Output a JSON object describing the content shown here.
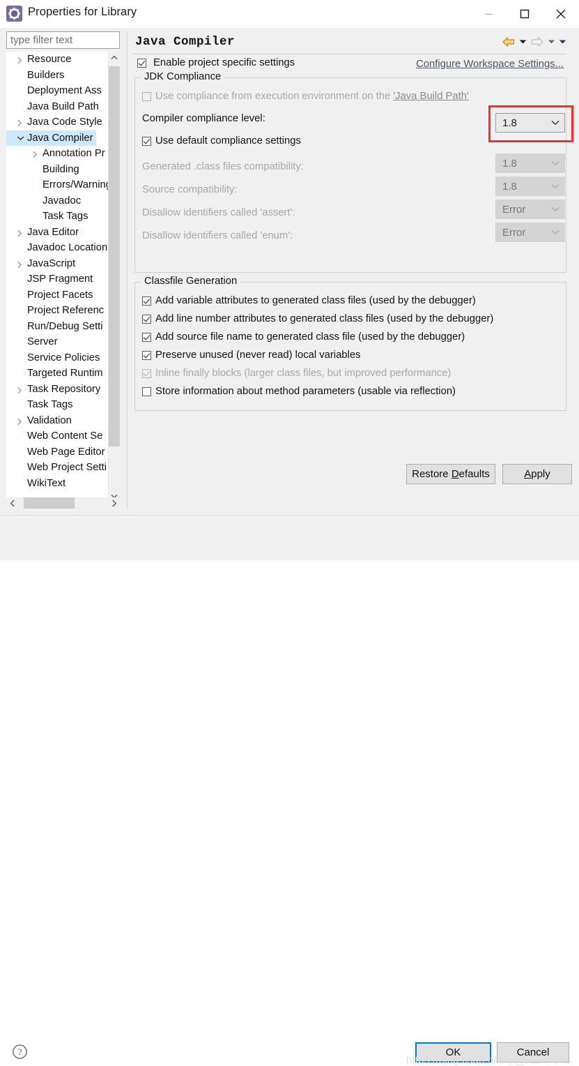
{
  "window": {
    "title": "Properties for Library",
    "icon": "eclipse-properties-icon",
    "minimize_label": "—",
    "maximize_label": "□",
    "close_label": "✕"
  },
  "filter": {
    "placeholder": "type filter text",
    "value": ""
  },
  "tree": {
    "items": [
      {
        "label": "Resource",
        "level": 1,
        "arrow": "collapsed",
        "selected": false
      },
      {
        "label": "Builders",
        "level": 1,
        "arrow": "none",
        "selected": false
      },
      {
        "label": "Deployment Ass",
        "level": 1,
        "arrow": "none",
        "selected": false
      },
      {
        "label": "Java Build Path",
        "level": 1,
        "arrow": "none",
        "selected": false
      },
      {
        "label": "Java Code Style",
        "level": 1,
        "arrow": "collapsed",
        "selected": false
      },
      {
        "label": "Java Compiler",
        "level": 1,
        "arrow": "expanded",
        "selected": true
      },
      {
        "label": "Annotation Pr",
        "level": 2,
        "arrow": "collapsed",
        "selected": false
      },
      {
        "label": "Building",
        "level": 2,
        "arrow": "none",
        "selected": false
      },
      {
        "label": "Errors/Warning",
        "level": 2,
        "arrow": "none",
        "selected": false
      },
      {
        "label": "Javadoc",
        "level": 2,
        "arrow": "none",
        "selected": false
      },
      {
        "label": "Task Tags",
        "level": 2,
        "arrow": "none",
        "selected": false
      },
      {
        "label": "Java Editor",
        "level": 1,
        "arrow": "collapsed",
        "selected": false
      },
      {
        "label": "Javadoc Location",
        "level": 1,
        "arrow": "none",
        "selected": false
      },
      {
        "label": "JavaScript",
        "level": 1,
        "arrow": "collapsed",
        "selected": false
      },
      {
        "label": "JSP Fragment",
        "level": 1,
        "arrow": "none",
        "selected": false
      },
      {
        "label": "Project Facets",
        "level": 1,
        "arrow": "none",
        "selected": false
      },
      {
        "label": "Project Referenc",
        "level": 1,
        "arrow": "none",
        "selected": false
      },
      {
        "label": "Run/Debug Setti",
        "level": 1,
        "arrow": "none",
        "selected": false
      },
      {
        "label": "Server",
        "level": 1,
        "arrow": "none",
        "selected": false
      },
      {
        "label": "Service Policies",
        "level": 1,
        "arrow": "none",
        "selected": false
      },
      {
        "label": "Targeted Runtim",
        "level": 1,
        "arrow": "none",
        "selected": false
      },
      {
        "label": "Task Repository",
        "level": 1,
        "arrow": "collapsed",
        "selected": false
      },
      {
        "label": "Task Tags",
        "level": 1,
        "arrow": "none",
        "selected": false
      },
      {
        "label": "Validation",
        "level": 1,
        "arrow": "collapsed",
        "selected": false
      },
      {
        "label": "Web Content Se",
        "level": 1,
        "arrow": "none",
        "selected": false
      },
      {
        "label": "Web Page Editor",
        "level": 1,
        "arrow": "none",
        "selected": false
      },
      {
        "label": "Web Project Setti",
        "level": 1,
        "arrow": "none",
        "selected": false
      },
      {
        "label": "WikiText",
        "level": 1,
        "arrow": "none",
        "selected": false
      }
    ]
  },
  "page": {
    "title": "Java Compiler",
    "nav": {
      "back_icon": "back-arrow-icon",
      "back_menu_icon": "chevron-down-icon",
      "forward_icon": "forward-arrow-icon",
      "forward_menu_icon": "chevron-down-icon",
      "view_menu_icon": "chevron-down-icon"
    },
    "enable_project_specific": {
      "label": "Enable project specific settings",
      "checked": true
    },
    "configure_workspace_link": "Configure Workspace Settings..."
  },
  "jdk_compliance": {
    "legend": "JDK Compliance",
    "use_execution_env": {
      "label_prefix": "Use compliance from execution environment on the ",
      "label_link": "'Java Build Path'",
      "checked": false,
      "enabled": false
    },
    "compliance_level": {
      "label": "Compiler compliance level:",
      "value": "1.8",
      "enabled": true,
      "highlighted": true
    },
    "use_default_settings": {
      "label": "Use default compliance settings",
      "checked": true,
      "enabled": true
    },
    "fields": [
      {
        "label": "Generated .class files compatibility:",
        "value": "1.8",
        "enabled": false
      },
      {
        "label": "Source compatibility:",
        "value": "1.8",
        "enabled": false
      },
      {
        "label": "Disallow identifiers called 'assert':",
        "value": "Error",
        "enabled": false
      },
      {
        "label": "Disallow identifiers called 'enum':",
        "value": "Error",
        "enabled": false
      }
    ]
  },
  "classfile_generation": {
    "legend": "Classfile Generation",
    "options": [
      {
        "label": "Add variable attributes to generated class files (used by the debugger)",
        "checked": true,
        "enabled": true
      },
      {
        "label": "Add line number attributes to generated class files (used by the debugger)",
        "checked": true,
        "enabled": true
      },
      {
        "label": "Add source file name to generated class file (used by the debugger)",
        "checked": true,
        "enabled": true
      },
      {
        "label": "Preserve unused (never read) local variables",
        "checked": true,
        "enabled": true
      },
      {
        "label": "Inline finally blocks (larger class files, but improved performance)",
        "checked": true,
        "enabled": false
      },
      {
        "label": "Store information about method parameters (usable via reflection)",
        "checked": false,
        "enabled": true
      }
    ]
  },
  "buttons": {
    "restore_defaults": "Restore Defaults",
    "apply": "Apply",
    "ok": "OK",
    "cancel": "Cancel"
  },
  "help": {
    "icon": "question-mark-icon"
  },
  "watermark": "https://blog.csdn.net/qq_51174391",
  "colors": {
    "accent_selection": "#cde8ff",
    "highlight_box": "#fd2a2a",
    "default_button_border": "#0078d7",
    "link": "#4d5561",
    "dialog_bg": "#f0f0f0"
  }
}
